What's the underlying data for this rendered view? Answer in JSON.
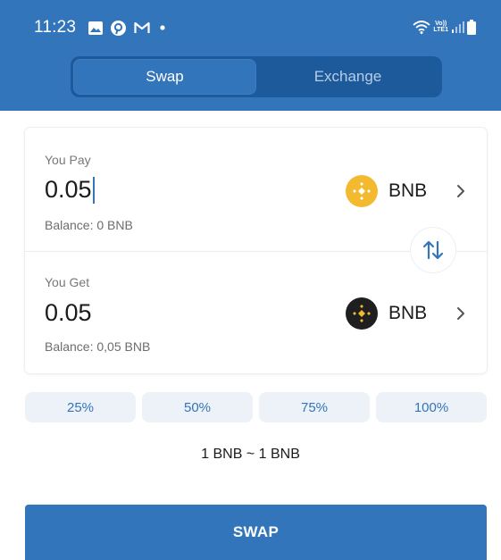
{
  "status_bar": {
    "time": "11:23",
    "icons": [
      "gallery-icon",
      "pinterest-icon",
      "gmail-icon",
      "dot-icon",
      "wifi-icon",
      "volte-lte-icon",
      "signal-icon",
      "battery-icon"
    ],
    "volte_top": "Vo))",
    "volte_bottom": "LTE1"
  },
  "tabs": [
    {
      "label": "Swap",
      "active": true
    },
    {
      "label": "Exchange",
      "active": false
    }
  ],
  "pay": {
    "label": "You Pay",
    "amount": "0.05",
    "token": "BNB",
    "balance": "Balance: 0 BNB"
  },
  "get": {
    "label": "You Get",
    "amount": "0.05",
    "token": "BNB",
    "balance": "Balance: 0,05 BNB"
  },
  "percent_buttons": [
    "25%",
    "50%",
    "75%",
    "100%"
  ],
  "rate": "1 BNB ~ 1 BNB",
  "swap_button": "SWAP",
  "colors": {
    "brand": "#3375bb",
    "bnb_yellow": "#f3ba2f",
    "bnb_dark": "#1f1f1f"
  }
}
